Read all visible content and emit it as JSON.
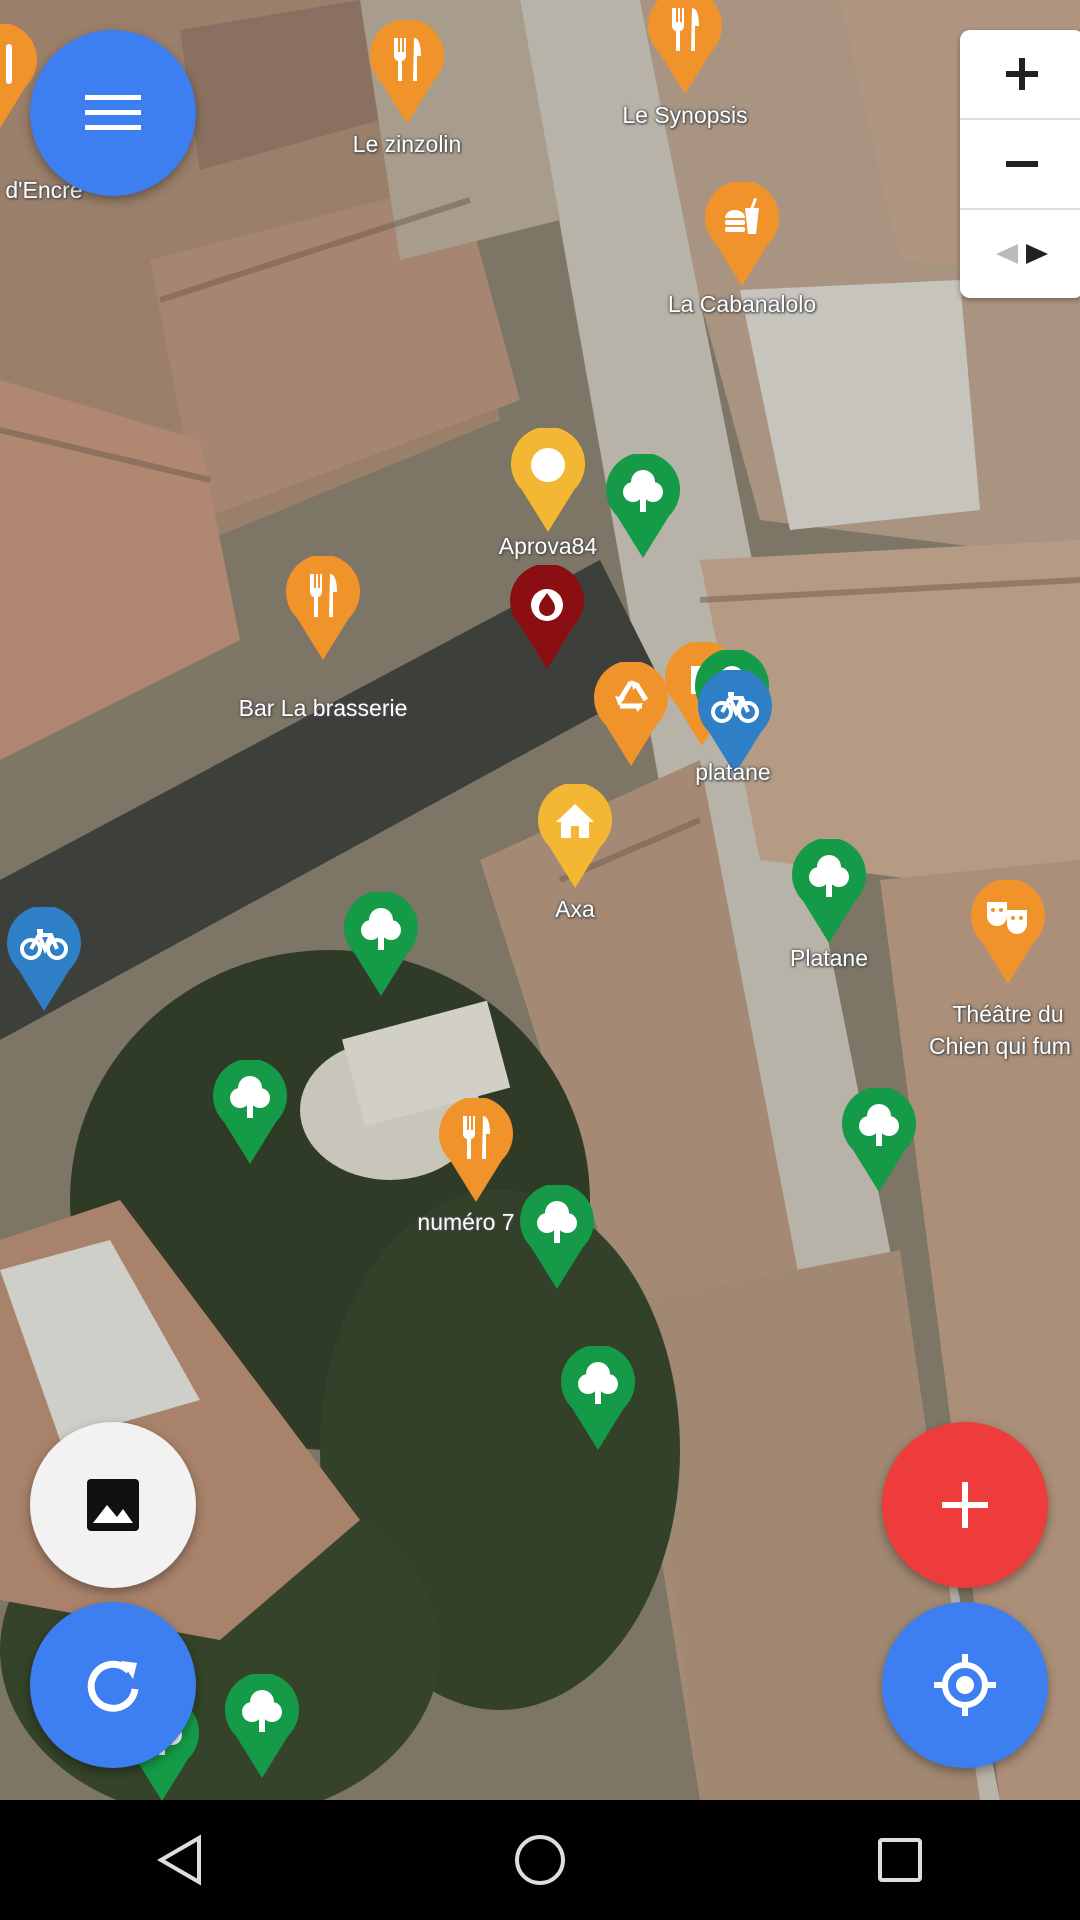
{
  "map": {
    "labels": {
      "encre": "d'Encre",
      "zinzolin": "Le zinzolin",
      "synopsis": "Le Synopsis",
      "cabanalolo": "La Cabanalolo",
      "aprova": "Aprova84",
      "brasserie": "Bar La brasserie",
      "platane_small": "platane",
      "axa": "Axa",
      "platane": "Platane",
      "theatre_l1": "Théâtre du",
      "theatre_l2": "Chien qui fum",
      "numero": "numéro 7"
    },
    "colors": {
      "restaurant": "#f0932b",
      "fastfood": "#f0932b",
      "office": "#f4b733",
      "tree": "#159a48",
      "fire": "#8b0f12",
      "bicycle": "#2f7fc7",
      "recycling": "#f0932b",
      "theatre": "#f0932b"
    }
  },
  "zoom_control": {
    "in_icon": "plus-icon",
    "out_icon": "minus-icon",
    "rotate_icon": "compass-arrows-icon"
  },
  "fabs": {
    "menu": {
      "icon": "menu-icon",
      "color": "#3d7ef0"
    },
    "layers": {
      "icon": "image-icon",
      "color": "#f2f2f2"
    },
    "refresh": {
      "icon": "refresh-icon",
      "color": "#3d7ef0"
    },
    "add": {
      "icon": "plus-icon",
      "color": "#ee3b3b"
    },
    "locate": {
      "icon": "my-location-icon",
      "color": "#3d7ef0"
    }
  },
  "navbar": {
    "back": "back-icon",
    "home": "home-icon",
    "recents": "recents-icon"
  }
}
